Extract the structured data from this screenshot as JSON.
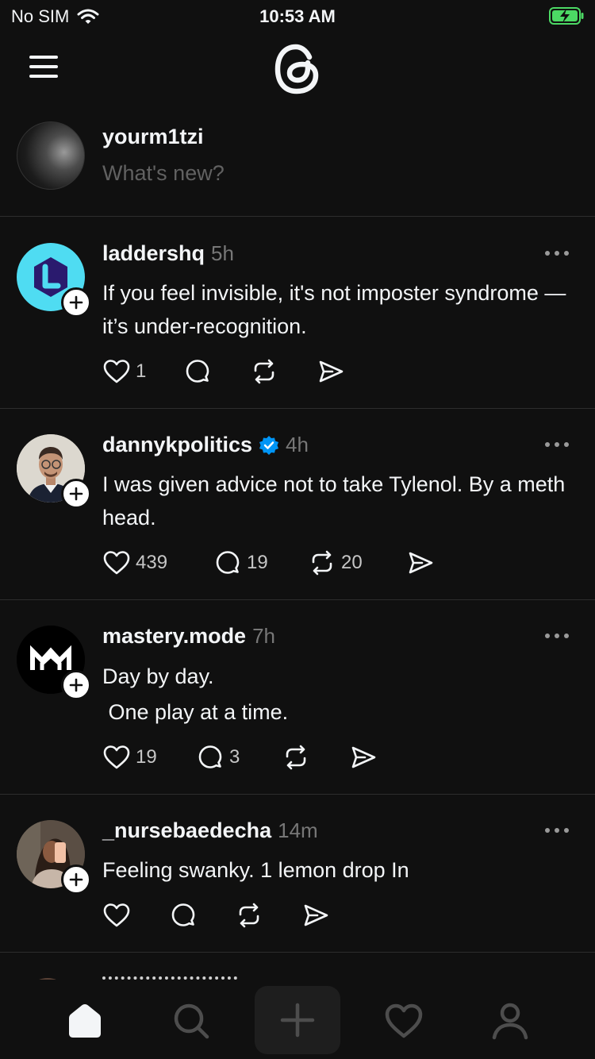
{
  "status_bar": {
    "carrier": "No SIM",
    "time": "10:53 AM"
  },
  "composer": {
    "username": "yourm1tzi",
    "placeholder": "What's new?"
  },
  "posts": [
    {
      "handle": "laddershq",
      "time": "5h",
      "verified": false,
      "text": "If you feel invisible, it's not imposter syndrome — it’s under-recognition.",
      "likes": "1",
      "replies": "",
      "reposts": ""
    },
    {
      "handle": "dannykpolitics",
      "time": "4h",
      "verified": true,
      "text": "I was given advice not to take Tylenol. By a meth head.",
      "likes": "439",
      "replies": "19",
      "reposts": "20"
    },
    {
      "handle": "mastery.mode",
      "time": "7h",
      "verified": false,
      "text": "Day by day.\n One play at a time.",
      "likes": "19",
      "replies": "3",
      "reposts": ""
    },
    {
      "handle": "_nursebaedecha",
      "time": "14m",
      "verified": false,
      "text": "Feeling swanky. 1 lemon drop In",
      "likes": "",
      "replies": "",
      "reposts": ""
    }
  ],
  "colors": {
    "background": "#101010",
    "text": "#f3f5f7",
    "muted": "#777777",
    "verified": "#0095f6",
    "battery": "#4cd964",
    "ladders_avatar": "#4fdcf2"
  },
  "icons": {
    "status": [
      "wifi-icon",
      "battery-charging-icon"
    ],
    "topbar": [
      "menu-icon",
      "threads-logo"
    ],
    "post_actions": [
      "heart-icon",
      "reply-icon",
      "repost-icon",
      "share-icon"
    ],
    "tabbar": [
      "home-icon",
      "search-icon",
      "plus-icon",
      "heart-icon",
      "profile-icon"
    ]
  }
}
